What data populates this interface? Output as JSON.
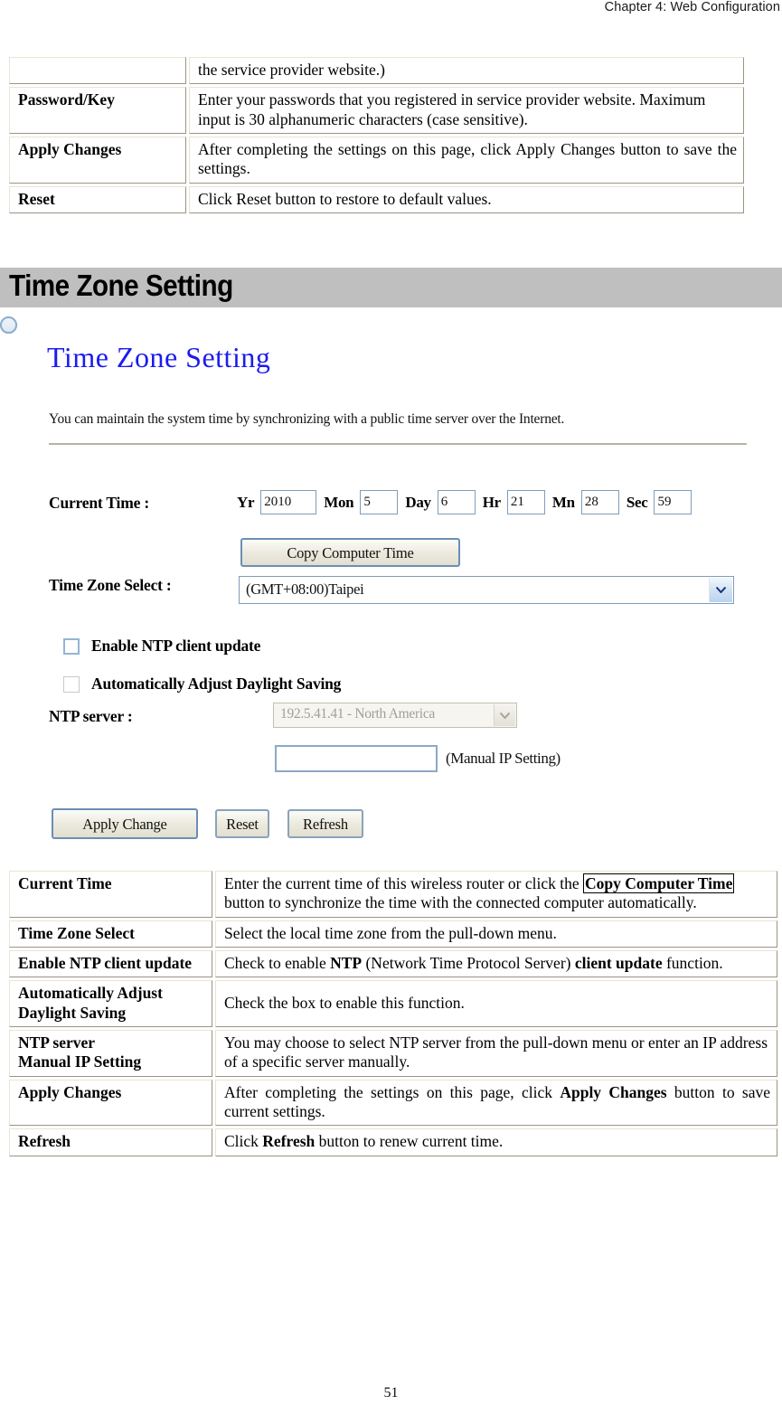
{
  "header": {
    "running_head": "Chapter 4: Web Configuration"
  },
  "top_table": {
    "rows": [
      {
        "key": "",
        "value": "the service provider website.)"
      },
      {
        "key": "Password/Key",
        "value": "Enter your passwords that you registered in service provider website. Maximum input is 30 alphanumeric characters (case sensitive)."
      },
      {
        "key": "Apply Changes",
        "value": "After completing the settings on this page, click Apply Changes button to save the settings."
      },
      {
        "key": "Reset",
        "value": "Click Reset button to restore to default values."
      }
    ]
  },
  "section": {
    "title": "Time Zone Setting"
  },
  "screenshot": {
    "title": "Time Zone Setting",
    "description": "You can maintain the system time by synchronizing with a public time server over the Internet.",
    "current_time": {
      "label": "Current Time :",
      "fields": [
        {
          "unit": "Yr",
          "value": "2010"
        },
        {
          "unit": "Mon",
          "value": "5"
        },
        {
          "unit": "Day",
          "value": "6"
        },
        {
          "unit": "Hr",
          "value": "21"
        },
        {
          "unit": "Mn",
          "value": "28"
        },
        {
          "unit": "Sec",
          "value": "59"
        }
      ],
      "copy_button": "Copy Computer Time"
    },
    "time_zone": {
      "label": "Time Zone Select :",
      "selected": "(GMT+08:00)Taipei"
    },
    "checkboxes": [
      {
        "label": "Enable NTP client update",
        "checked": false
      },
      {
        "label": "Automatically Adjust Daylight Saving",
        "checked": false
      }
    ],
    "ntp": {
      "label": "NTP server :",
      "server_selected": "192.5.41.41 - North America",
      "manual_ip_value": "",
      "manual_note": "(Manual IP Setting)",
      "selected_radio": "server"
    },
    "buttons": {
      "apply": "Apply Change",
      "reset": "Reset",
      "refresh": "Refresh"
    }
  },
  "desc_table": {
    "rows": [
      {
        "key": "Current Time",
        "value_parts": [
          {
            "t": "Enter the current time of this wireless router or click the ",
            "b": false
          },
          {
            "t": "Copy Computer Time",
            "b": true
          },
          {
            "t": " button to synchronize the time with the connected computer automatically.",
            "b": false
          }
        ]
      },
      {
        "key": "Time Zone Select",
        "value_parts": [
          {
            "t": "Select the local time zone from the pull-down menu.",
            "b": false
          }
        ]
      },
      {
        "key": "Enable NTP client update",
        "value_parts": [
          {
            "t": "Check to enable ",
            "b": false
          },
          {
            "t": "NTP",
            "b": true
          },
          {
            "t": " (Network Time Protocol Server) ",
            "b": false
          },
          {
            "t": "client update",
            "b": true
          },
          {
            "t": " function.",
            "b": false
          }
        ]
      },
      {
        "key": "Automatically Adjust Daylight Saving",
        "value_parts": [
          {
            "t": "Check the box to enable this function.",
            "b": false
          }
        ]
      },
      {
        "key": "NTP server Manual IP Setting",
        "value_parts": [
          {
            "t": "You may choose to select NTP server from the pull-down menu or enter an IP address of a specific server manually.",
            "b": false
          }
        ]
      },
      {
        "key": "Apply Changes",
        "value_parts": [
          {
            "t": "After completing the settings on this page, click ",
            "b": false
          },
          {
            "t": "Apply Changes",
            "b": true
          },
          {
            "t": " button to save current settings.",
            "b": false
          }
        ]
      },
      {
        "key": "Refresh",
        "value_parts": [
          {
            "t": "Click ",
            "b": false
          },
          {
            "t": "Refresh",
            "b": true
          },
          {
            "t": " button to renew current time.",
            "b": false
          }
        ]
      }
    ]
  },
  "footer": {
    "page_number": "51"
  }
}
